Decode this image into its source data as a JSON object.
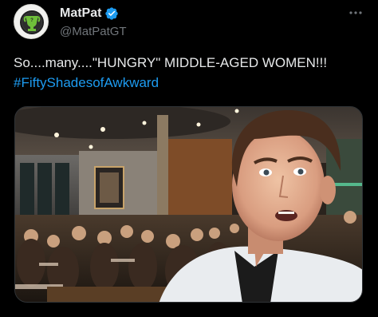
{
  "author": {
    "display_name": "MatPat",
    "handle": "@MatPatGT",
    "verified": true,
    "avatar_icon": "game-theory-logo-icon"
  },
  "tweet": {
    "text_line1": "So....many....\"HUNGRY\" MIDDLE-AGED WOMEN!!!",
    "hashtag": "#FiftyShadesofAwkward"
  },
  "media": {
    "description_icon": "selfie-photo"
  },
  "colors": {
    "background": "#000000",
    "text": "#e7e9ea",
    "secondary_text": "#71767b",
    "link": "#1d9bf0",
    "verified_badge": "#1d9bf0"
  }
}
